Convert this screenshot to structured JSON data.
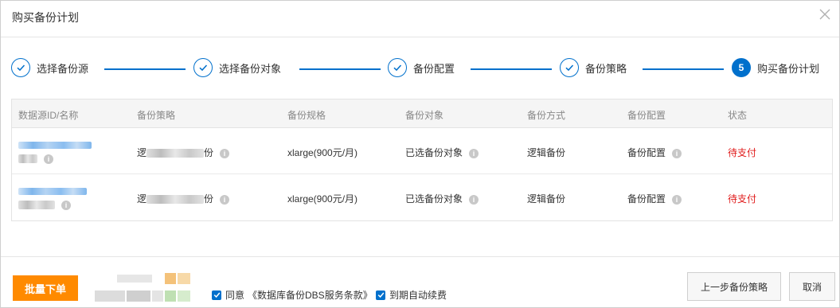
{
  "dialog": {
    "title": "购买备份计划"
  },
  "steps": [
    {
      "label": "选择备份源",
      "state": "done"
    },
    {
      "label": "选择备份对象",
      "state": "done"
    },
    {
      "label": "备份配置",
      "state": "done"
    },
    {
      "label": "备份策略",
      "state": "done"
    },
    {
      "label": "购买备份计划",
      "state": "active",
      "number": "5"
    }
  ],
  "table": {
    "columns": [
      "数据源ID/名称",
      "备份策略",
      "备份规格",
      "备份对象",
      "备份方式",
      "备份配置",
      "状态"
    ],
    "rows": [
      {
        "source_id": "",
        "source_name": "",
        "policy": "逻",
        "policy_suffix": "份",
        "spec": "xlarge(900元/月)",
        "object": "已选备份对象",
        "method": "逻辑备份",
        "config": "备份配置",
        "status": "待支付"
      },
      {
        "source_id": "",
        "source_name": "",
        "policy": "逻",
        "policy_suffix": "份",
        "spec": "xlarge(900元/月)",
        "object": "已选备份对象",
        "method": "逻辑备份",
        "config": "备份配置",
        "status": "待支付"
      }
    ]
  },
  "footer": {
    "buy_button": "批量下单",
    "agree_label": "同意",
    "agree_terms": "《数据库备份DBS服务条款》",
    "auto_renew_label": "到期自动续费",
    "prev_button": "上一步备份策略",
    "cancel_button": "取消"
  },
  "colors": {
    "primary": "#0070cc",
    "accent": "#ff8a00",
    "status": "#e01b1b",
    "link": "#1a7dd8"
  },
  "icons": {
    "close": "close-icon",
    "check": "check-icon",
    "info": "info-icon"
  }
}
